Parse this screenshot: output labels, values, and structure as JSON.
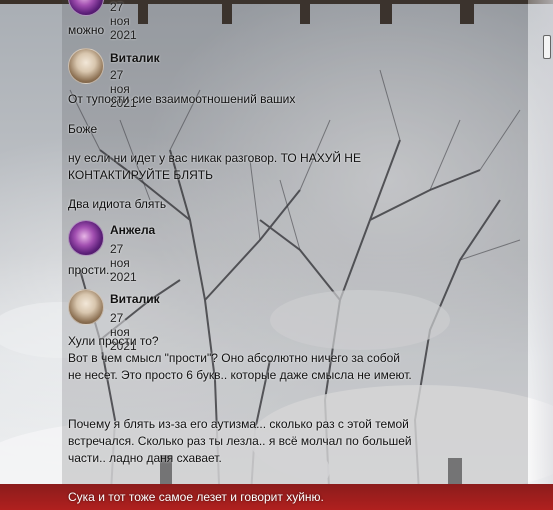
{
  "messages": [
    {
      "time": "27 ноя 2021"
    },
    {
      "text": "можно"
    },
    {
      "author": "Виталик",
      "time": "27 ноя 2021"
    },
    {
      "text": "От тупости сие взаимоотношений ваших"
    },
    {
      "text": "Боже"
    },
    {
      "text": "ну если ни идет у вас никак разговор. ТО НАХУЙ НЕ КОНТАКТИРУЙТЕ БЛЯТЬ"
    },
    {
      "text": "Два идиота блять"
    },
    {
      "author": "Анжела",
      "time": "27 ноя 2021"
    },
    {
      "text": "прости.."
    },
    {
      "author": "Виталик",
      "time": "27 ноя 2021"
    },
    {
      "text": "Хули прости то?\nВот в чем смысл \"прости\"? Оно абсолютно ничего за собой не несет. Это просто 6 букв.. которые даже смысла не имеют."
    },
    {
      "text": "Почему я блять из-за его аутизма... сколько раз с этой темой встречался. Сколько раз ты лезла.. я всё молчал по большей части.. ладно даня схавает."
    },
    {
      "text": "Сука и тот тоже самое лезет и говорит хуйню."
    }
  ]
}
